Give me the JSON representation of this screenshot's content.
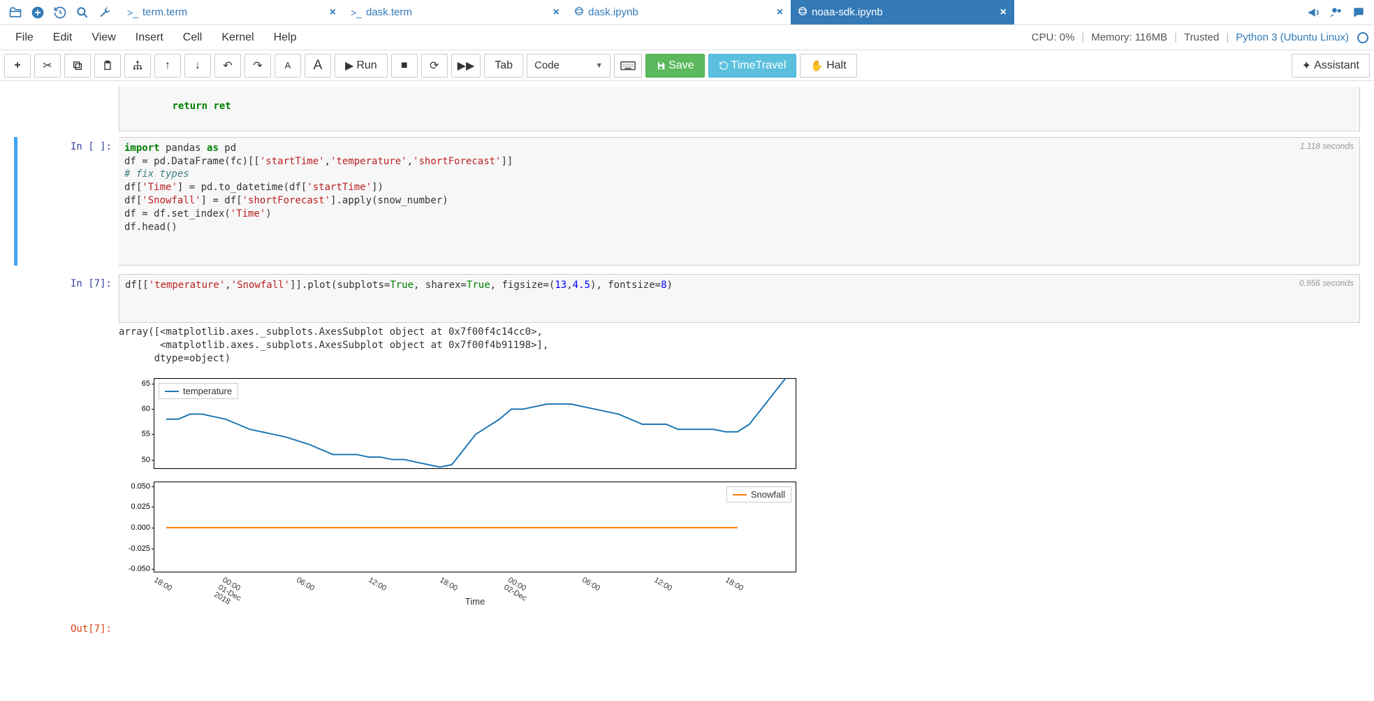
{
  "top_icons": [
    "folder-open",
    "plus-circle",
    "history",
    "search",
    "wrench"
  ],
  "tabs": [
    {
      "icon": ">_",
      "label": "term.term",
      "active": false
    },
    {
      "icon": ">_",
      "label": "dask.term",
      "active": false
    },
    {
      "icon": "nb",
      "label": "dask.ipynb",
      "active": false
    },
    {
      "icon": "nb",
      "label": "noaa-sdk.ipynb",
      "active": true
    }
  ],
  "right_icons": [
    "megaphone",
    "users",
    "chat"
  ],
  "menu": [
    "File",
    "Edit",
    "View",
    "Insert",
    "Cell",
    "Kernel",
    "Help"
  ],
  "status": {
    "cpu": "CPU: 0%",
    "mem": "Memory: 116MB",
    "trusted": "Trusted",
    "kernel": "Python 3 (Ubuntu Linux)"
  },
  "actions": {
    "run": "Run",
    "tab": "Tab",
    "save": "Save",
    "timetravel": "TimeTravel",
    "halt": "Halt",
    "assistant": "Assistant"
  },
  "cell_type": "Code",
  "truncated_prev": "return ret",
  "cells": [
    {
      "prompt": "In [ ]:",
      "timing": "1.118 seconds",
      "code_html": "<span class='ky'>import</span> pandas <span class='ky'>as</span> pd\ndf = pd.DataFrame(fc)[[<span class='st'>'startTime'</span>,<span class='st'>'temperature'</span>,<span class='st'>'shortForecast'</span>]]\n<span class='cm'># fix types</span>\ndf[<span class='st'>'Time'</span>] = pd.to_datetime(df[<span class='st'>'startTime'</span>])\ndf[<span class='st'>'Snowfall'</span>] = df[<span class='st'>'shortForecast'</span>].apply(snow_number)\ndf = df.set_index(<span class='st'>'Time'</span>)\ndf.head()",
      "selected": true
    },
    {
      "prompt": "In [7]:",
      "timing": "0.956 seconds",
      "code_html": "df[[<span class='st'>'temperature'</span>,<span class='st'>'Snowfall'</span>]].plot(subplots=<span class='bn'>True</span>, sharex=<span class='bn'>True</span>, figsize=(<span class='nm'>13</span>,<span class='nm'>4.5</span>), fontsize=<span class='nm'>8</span>)",
      "output_text": "array([<matplotlib.axes._subplots.AxesSubplot object at 0x7f00f4c14cc0>,\n       <matplotlib.axes._subplots.AxesSubplot object at 0x7f00f4b91198>],\n      dtype=object)"
    }
  ],
  "out_prompt": "Out[7]:",
  "chart_data": [
    {
      "type": "line",
      "title": "",
      "legend": "temperature",
      "legend_pos": "top-left",
      "color": "#1f77b4",
      "ylim": [
        48,
        66
      ],
      "yticks": [
        50,
        55,
        60,
        65
      ],
      "x_categories": [
        "18:00",
        "00:00\n01-Dec\n2018",
        "06:00",
        "12:00",
        "18:00",
        "00:00\n02-Dec",
        "06:00",
        "12:00",
        "18:00"
      ],
      "x_hours": [
        18,
        24,
        30,
        36,
        42,
        48,
        54,
        60,
        66
      ],
      "series": [
        {
          "name": "temperature",
          "x": [
            18,
            19,
            20,
            21,
            22,
            23,
            24,
            25,
            26,
            27,
            28,
            30,
            32,
            34,
            35,
            36,
            37,
            38,
            39,
            40,
            41,
            42,
            43,
            44,
            46,
            47,
            48,
            50,
            52,
            54,
            56,
            58,
            60,
            61,
            62,
            63,
            64,
            65,
            66
          ],
          "y": [
            58,
            58,
            59,
            59,
            58.5,
            58,
            57,
            56,
            55.5,
            55,
            54.5,
            53,
            51,
            51,
            50.5,
            50.5,
            50,
            50,
            49.5,
            49,
            48.5,
            49,
            52,
            55,
            58,
            60,
            60,
            61,
            61,
            60,
            59,
            57,
            57,
            56,
            56,
            56,
            56,
            55.5,
            55.5
          ]
        }
      ],
      "extra_tail": [
        {
          "x": 66,
          "y": 55.5
        },
        {
          "x": 67,
          "y": 57
        },
        {
          "x": 68,
          "y": 60
        },
        {
          "x": 69,
          "y": 63
        },
        {
          "x": 70,
          "y": 66
        }
      ]
    },
    {
      "type": "line",
      "title": "",
      "legend": "Snowfall",
      "legend_pos": "top-right",
      "color": "#ff7f0e",
      "ylim": [
        -0.055,
        0.055
      ],
      "yticks": [
        -0.05,
        -0.025,
        0.0,
        0.025,
        0.05
      ],
      "xlabel": "Time",
      "x_categories": [
        "18:00",
        "00:00\n01-Dec\n2018",
        "06:00",
        "12:00",
        "18:00",
        "00:00\n02-Dec",
        "06:00",
        "12:00",
        "18:00"
      ],
      "x_hours": [
        18,
        24,
        30,
        36,
        42,
        48,
        54,
        60,
        66
      ],
      "series": [
        {
          "name": "Snowfall",
          "x": [
            18,
            66
          ],
          "y": [
            0,
            0
          ]
        }
      ]
    }
  ]
}
